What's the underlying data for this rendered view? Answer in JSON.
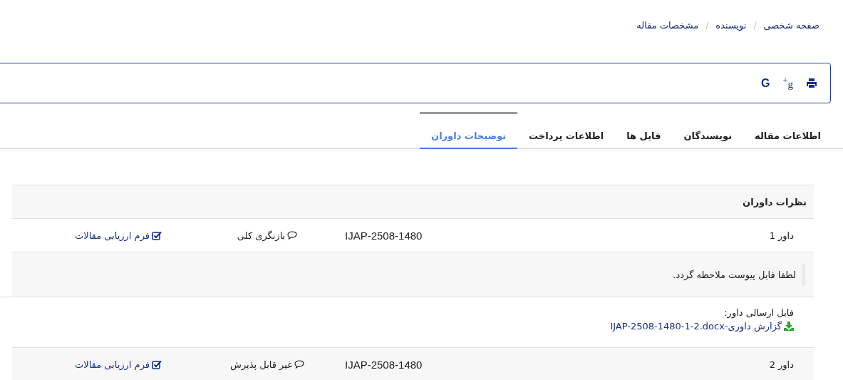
{
  "breadcrumb": [
    {
      "kind": "link",
      "text": "صفحه شخصی"
    },
    {
      "kind": "separator",
      "text": "/"
    },
    {
      "kind": "link",
      "text": "نویسنده"
    },
    {
      "kind": "separator",
      "text": "/"
    },
    {
      "kind": "link",
      "text": "مشخصات مقاله"
    }
  ],
  "toolbar": {
    "buttons": [
      {
        "kind": "print"
      },
      {
        "kind": "googleplus",
        "glyph": "g$^{+}$"
      },
      {
        "kind": "google",
        "glyph": "G"
      }
    ]
  },
  "tabs": [
    {
      "label": "اطلاعات مقاله",
      "selected": false
    },
    {
      "label": "نویسندگان",
      "selected": false
    },
    {
      "label": "فایل ها",
      "selected": false
    },
    {
      "label": "اطلاعات پرداخت",
      "selected": false
    },
    {
      "label": "توضیحات داوران",
      "selected": true
    }
  ],
  "reviews": {
    "title": "نظرات داوران",
    "reviewers": [
      {
        "name": "داور 1",
        "code": "IJAP-2508-1480",
        "decision": "بازنگری کلی",
        "form_link": "فرم ارزیابی مقالات",
        "comment": "لطفا فایل پیوست ملاحظه گردد.",
        "file_label": "فایل ارسالی داور:",
        "file_link": "گزارش داوری-IJAP-2508-1480-1-2.docx"
      },
      {
        "name": "داور 2",
        "code": "IJAP-2508-1480",
        "decision": "غیر قابل پذیرش",
        "form_link": "فرم ارزیابی مقالات"
      }
    ]
  }
}
